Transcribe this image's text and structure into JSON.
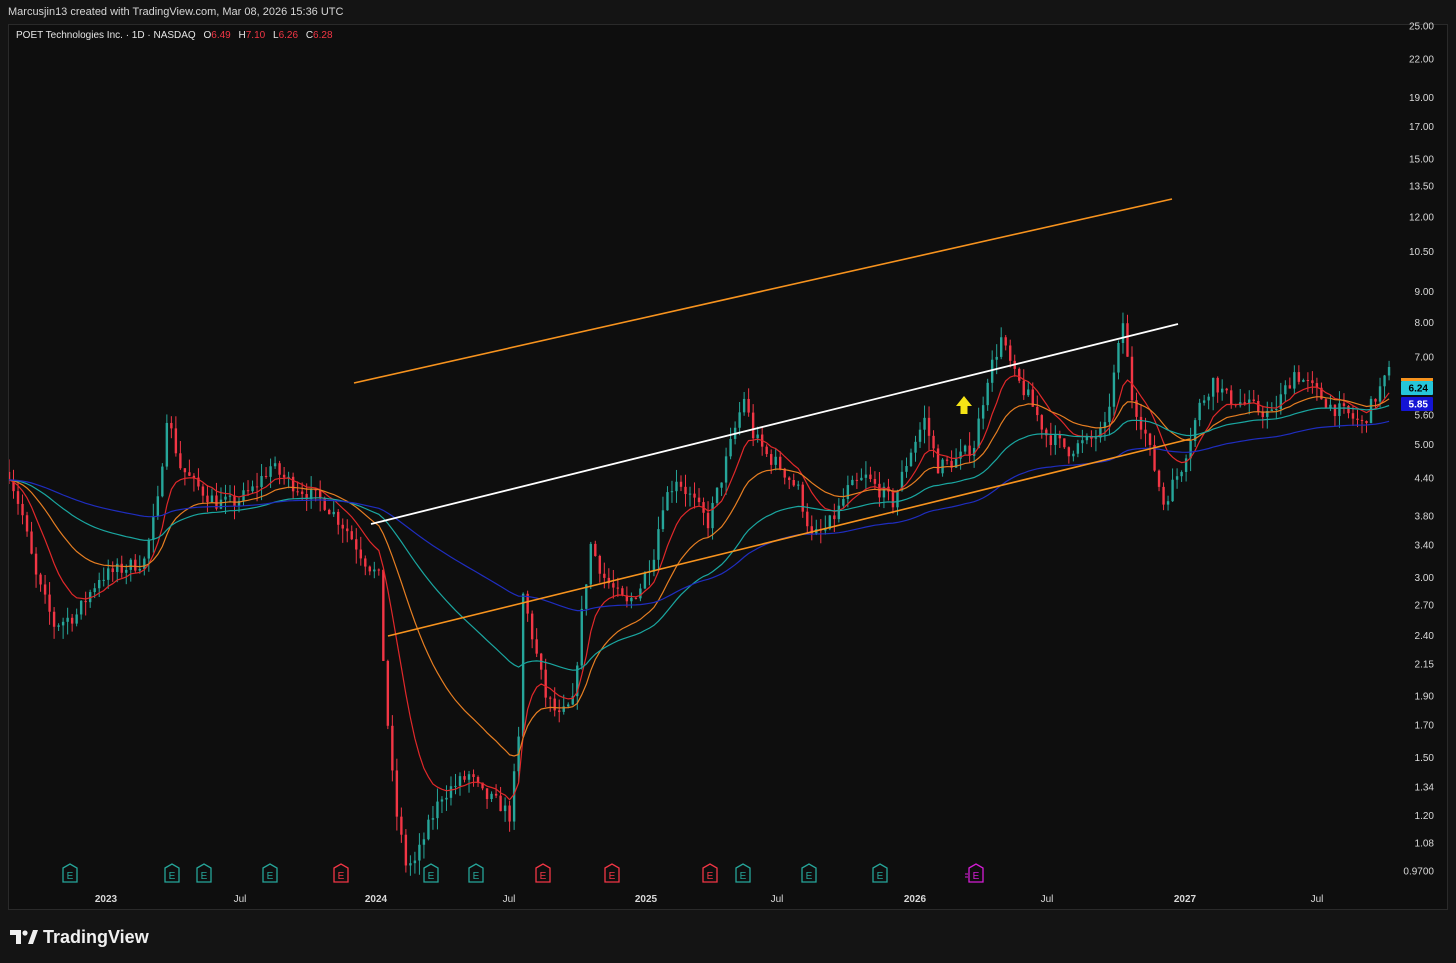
{
  "header": {
    "attribution": "Marcusjin13 created with TradingView.com, Mar 08, 2026 15:36 UTC"
  },
  "legend": {
    "symbol": "POET Technologies Inc. · 1D · NASDAQ",
    "open_label": "O",
    "open": "6.49",
    "high_label": "H",
    "high": "7.10",
    "low_label": "L",
    "low": "6.26",
    "close_label": "C",
    "close": "6.28"
  },
  "brand": {
    "name": "TradingView"
  },
  "colors": {
    "background": "#0e0e0e",
    "up_candle": "#26a69a",
    "down_candle": "#f23645",
    "channel": "#f7931e",
    "midline": "#ffffff",
    "ma_fast": "#e0282a",
    "ma_mid": "#e67e22",
    "ma_slow": "#1aa6a0",
    "ma_long": "#1f2dbf",
    "arrow": "#f5e416",
    "price_cyan": "#26c6da",
    "price_blue": "#1414d4",
    "earnings_past": "#26a69a",
    "earnings_miss": "#f23645",
    "earnings_future": "#d51dd5"
  },
  "chart_data": {
    "type": "candlestick",
    "scale": "log",
    "ylim": [
      0.95,
      25.5
    ],
    "y_ticks": [
      "25.00",
      "22.00",
      "19.00",
      "17.00",
      "15.00",
      "13.50",
      "12.00",
      "10.50",
      "9.00",
      "8.00",
      "7.00",
      "5.60",
      "5.00",
      "4.40",
      "3.80",
      "3.40",
      "3.00",
      "2.70",
      "2.40",
      "2.15",
      "1.90",
      "1.70",
      "1.50",
      "1.34",
      "1.20",
      "1.08",
      "0.9700"
    ],
    "x_ticks": [
      "2023",
      "Jul",
      "2024",
      "Jul",
      "2025",
      "Jul",
      "2026",
      "Jul",
      "2027",
      "Jul"
    ],
    "price_labels": [
      {
        "value": "6.24",
        "color": "cyan"
      },
      {
        "value": "5.85",
        "color": "blue"
      }
    ],
    "earnings_markers": [
      {
        "label": "E",
        "type": "past"
      },
      {
        "label": "E",
        "type": "past"
      },
      {
        "label": "E",
        "type": "past"
      },
      {
        "label": "E",
        "type": "past"
      },
      {
        "label": "E",
        "type": "miss"
      },
      {
        "label": "E",
        "type": "past"
      },
      {
        "label": "E",
        "type": "past"
      },
      {
        "label": "E",
        "type": "miss"
      },
      {
        "label": "E",
        "type": "miss"
      },
      {
        "label": "E",
        "type": "miss"
      },
      {
        "label": "E",
        "type": "past"
      },
      {
        "label": "E",
        "type": "past"
      },
      {
        "label": "E",
        "type": "past"
      },
      {
        "label": "E",
        "type": "future"
      }
    ],
    "trend_lines": [
      {
        "name": "upper-channel",
        "color": "channel"
      },
      {
        "name": "mid-channel",
        "color": "midline"
      },
      {
        "name": "lower-channel",
        "color": "channel"
      }
    ],
    "price_path": [
      [
        0.0,
        4.5
      ],
      [
        0.6,
        3.8
      ],
      [
        1.2,
        3.0
      ],
      [
        2.0,
        2.5
      ],
      [
        3.0,
        2.6
      ],
      [
        4.0,
        3.0
      ],
      [
        5.0,
        3.1
      ],
      [
        6.0,
        3.2
      ],
      [
        6.6,
        4.0
      ],
      [
        7.0,
        5.6
      ],
      [
        7.6,
        4.6
      ],
      [
        8.2,
        4.3
      ],
      [
        9.2,
        4.0
      ],
      [
        10.0,
        4.0
      ],
      [
        10.8,
        4.2
      ],
      [
        11.6,
        4.6
      ],
      [
        12.2,
        4.4
      ],
      [
        13.0,
        4.2
      ],
      [
        14.0,
        4.0
      ],
      [
        15.0,
        3.6
      ],
      [
        15.8,
        3.2
      ],
      [
        16.4,
        3.0
      ],
      [
        16.6,
        2.2
      ],
      [
        16.9,
        1.5
      ],
      [
        17.2,
        1.2
      ],
      [
        17.6,
        1.0
      ],
      [
        18.0,
        1.0
      ],
      [
        18.4,
        1.1
      ],
      [
        18.8,
        1.2
      ],
      [
        19.2,
        1.3
      ],
      [
        19.8,
        1.35
      ],
      [
        20.4,
        1.4
      ],
      [
        21.0,
        1.3
      ],
      [
        21.8,
        1.25
      ],
      [
        22.2,
        1.2
      ],
      [
        22.6,
        1.6
      ],
      [
        22.8,
        2.8
      ],
      [
        23.2,
        2.4
      ],
      [
        23.8,
        1.9
      ],
      [
        24.4,
        1.75
      ],
      [
        25.0,
        1.85
      ],
      [
        25.4,
        2.6
      ],
      [
        25.8,
        3.4
      ],
      [
        26.4,
        3.0
      ],
      [
        27.0,
        2.8
      ],
      [
        27.4,
        2.7
      ],
      [
        28.0,
        2.9
      ],
      [
        28.6,
        3.3
      ],
      [
        29.0,
        4.0
      ],
      [
        29.6,
        4.4
      ],
      [
        30.4,
        4.0
      ],
      [
        31.0,
        3.7
      ],
      [
        31.6,
        4.4
      ],
      [
        32.0,
        5.0
      ],
      [
        32.6,
        6.0
      ],
      [
        33.0,
        5.2
      ],
      [
        33.6,
        4.8
      ],
      [
        34.2,
        4.6
      ],
      [
        35.0,
        4.2
      ],
      [
        35.6,
        3.5
      ],
      [
        36.2,
        3.6
      ],
      [
        36.8,
        3.9
      ],
      [
        37.2,
        4.2
      ],
      [
        38.0,
        4.4
      ],
      [
        38.6,
        4.2
      ],
      [
        39.2,
        4.0
      ],
      [
        40.0,
        4.9
      ],
      [
        40.6,
        5.5
      ],
      [
        41.2,
        4.6
      ],
      [
        42.0,
        4.7
      ],
      [
        42.8,
        5.0
      ],
      [
        43.4,
        6.5
      ],
      [
        44.0,
        7.5
      ],
      [
        44.6,
        6.5
      ],
      [
        45.2,
        6.0
      ],
      [
        46.0,
        5.2
      ],
      [
        47.0,
        4.9
      ],
      [
        48.0,
        5.1
      ],
      [
        48.6,
        5.3
      ],
      [
        49.4,
        8.0
      ],
      [
        49.8,
        6.0
      ],
      [
        50.4,
        5.2
      ],
      [
        51.2,
        4.0
      ],
      [
        52.0,
        4.6
      ],
      [
        52.8,
        5.8
      ],
      [
        53.4,
        6.4
      ],
      [
        54.0,
        6.0
      ],
      [
        55.0,
        5.8
      ],
      [
        56.0,
        5.6
      ],
      [
        57.0,
        6.6
      ],
      [
        57.8,
        6.2
      ],
      [
        58.6,
        5.8
      ],
      [
        59.4,
        5.6
      ],
      [
        60.0,
        5.4
      ],
      [
        60.6,
        6.0
      ],
      [
        61.4,
        6.8
      ]
    ]
  }
}
